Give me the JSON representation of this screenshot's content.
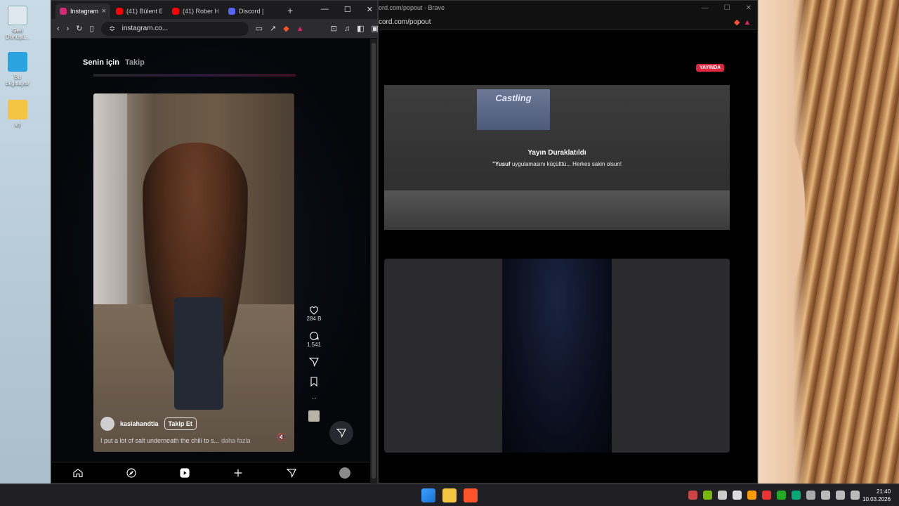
{
  "desktop": {
    "icons": [
      {
        "label": "Geri Dönüşü..."
      },
      {
        "label": "Bu bilgisayar"
      },
      {
        "label": "xd"
      }
    ]
  },
  "instagram_window": {
    "tabs": [
      {
        "label": "Instagram",
        "favicon_color": "#d62976",
        "active": true
      },
      {
        "label": "(41) Bülent E",
        "favicon_color": "#ff0000",
        "active": false
      },
      {
        "label": "(41) Rober H",
        "favicon_color": "#ff0000",
        "active": false
      },
      {
        "label": "Discord |",
        "favicon_color": "#5865f2",
        "active": false
      }
    ],
    "url": "instagram.co...",
    "feed_tabs": {
      "for_you": "Senin için",
      "following": "Takip"
    },
    "post": {
      "username": "kasiahandtia",
      "follow_label": "Takip Et",
      "caption": "I put a lot of salt underneath the chili to s...",
      "more_label": "daha fazla",
      "likes": "284 B",
      "comments": "1.541"
    }
  },
  "discord_window": {
    "title": "ord.com/popout - Brave",
    "url": "cord.com/popout",
    "live_badge": "YAYINDA",
    "sign_text": "Castling",
    "pause_title": "Yayın Duraklatıldı",
    "pause_user": "\"Yusuf",
    "pause_message": "uygulamasını küçülttü... Herkes sakin olsun!"
  },
  "taskbar": {
    "time": "21:40",
    "date": "10.03.2026"
  },
  "colors": {
    "instagram_accent": "#d62976",
    "live_red": "#e0263f",
    "discord_blurple": "#5865f2"
  }
}
